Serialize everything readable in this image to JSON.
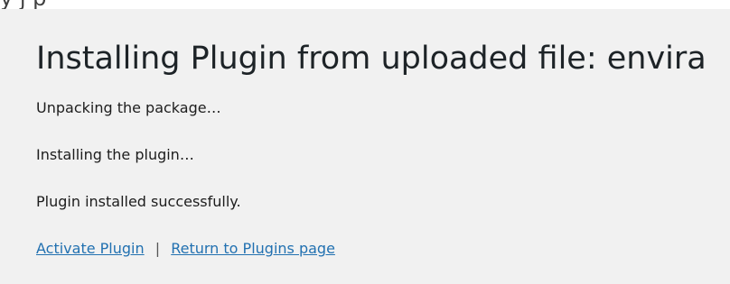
{
  "top_strip": {
    "partial_text": "y                                  j                                                  p"
  },
  "install": {
    "title": "Installing Plugin from uploaded file: envira",
    "messages": [
      "Unpacking the package…",
      "Installing the plugin…",
      "Plugin installed successfully."
    ],
    "actions": {
      "activate_label": "Activate Plugin",
      "separator": "|",
      "return_label": "Return to Plugins page"
    }
  }
}
